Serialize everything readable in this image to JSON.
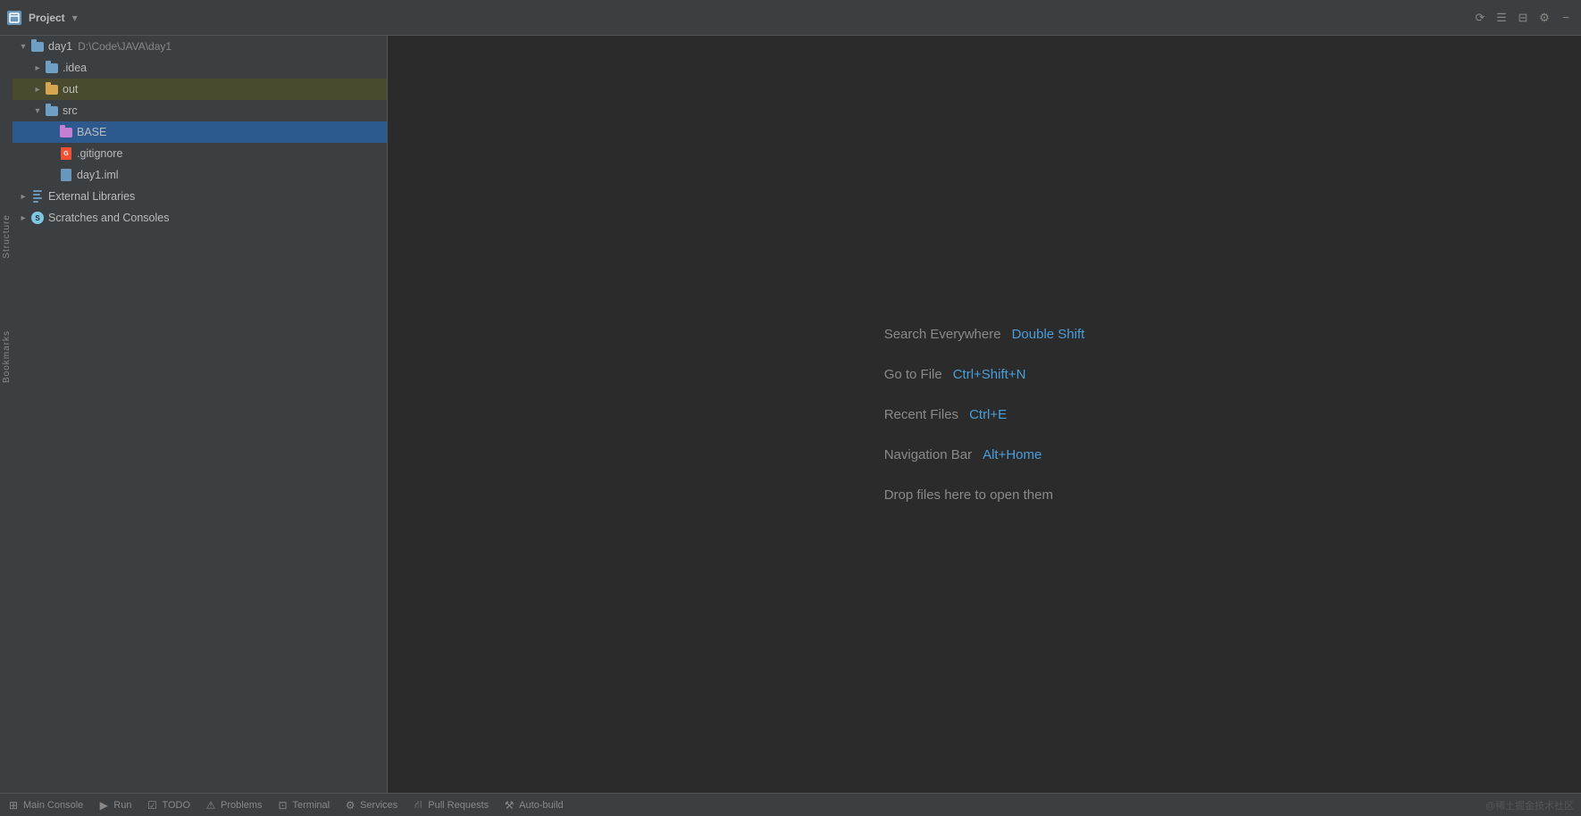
{
  "titleBar": {
    "projectIcon": "P",
    "projectName": "Project",
    "dropdownArrow": "▾"
  },
  "projectPanel": {
    "title": "Project",
    "root": {
      "name": "day1",
      "path": "D:\\Code\\JAVA\\day1"
    },
    "tree": [
      {
        "id": "idea",
        "label": ".idea",
        "indent": 1,
        "type": "folder-blue",
        "state": "collapsed"
      },
      {
        "id": "out",
        "label": "out",
        "indent": 1,
        "type": "folder-orange",
        "state": "collapsed",
        "highlighted": true
      },
      {
        "id": "src",
        "label": "src",
        "indent": 1,
        "type": "folder-blue",
        "state": "expanded"
      },
      {
        "id": "base",
        "label": "BASE",
        "indent": 2,
        "type": "folder-blue",
        "state": "leaf",
        "selected": true
      },
      {
        "id": "gitignore",
        "label": ".gitignore",
        "indent": 2,
        "type": "file-git",
        "state": "leaf"
      },
      {
        "id": "day1iml",
        "label": "day1.iml",
        "indent": 2,
        "type": "file-iml",
        "state": "leaf"
      },
      {
        "id": "external",
        "label": "External Libraries",
        "indent": 0,
        "type": "ext-lib",
        "state": "collapsed"
      },
      {
        "id": "scratches",
        "label": "Scratches and Consoles",
        "indent": 0,
        "type": "scratches",
        "state": "collapsed"
      }
    ]
  },
  "editor": {
    "searchEverywhere": {
      "label": "Search Everywhere",
      "shortcut": "Double Shift"
    },
    "goToFile": {
      "label": "Go to File",
      "shortcut": "Ctrl+Shift+N"
    },
    "recentFiles": {
      "label": "Recent Files",
      "shortcut": "Ctrl+E"
    },
    "navigationBar": {
      "label": "Navigation Bar",
      "shortcut": "Alt+Home"
    },
    "dropFiles": {
      "label": "Drop files here to open them"
    }
  },
  "statusBar": {
    "items": [
      {
        "id": "main",
        "label": "Main Console",
        "icon": "terminal"
      },
      {
        "id": "run",
        "label": "Run",
        "icon": "play"
      },
      {
        "id": "todo",
        "label": "TODO",
        "icon": "check"
      },
      {
        "id": "problems",
        "label": "Problems",
        "icon": "warning"
      },
      {
        "id": "terminal",
        "label": "Terminal",
        "icon": "terminal2"
      },
      {
        "id": "services",
        "label": "Services",
        "icon": "services"
      },
      {
        "id": "pullreq",
        "label": "Pull Requests",
        "icon": "pullreq"
      },
      {
        "id": "autobuild",
        "label": "Auto-build",
        "icon": "build"
      }
    ],
    "watermark": "@稀土掘金技术社区"
  },
  "sidebar": {
    "structure": "Structure",
    "bookmarks": "Bookmarks"
  }
}
